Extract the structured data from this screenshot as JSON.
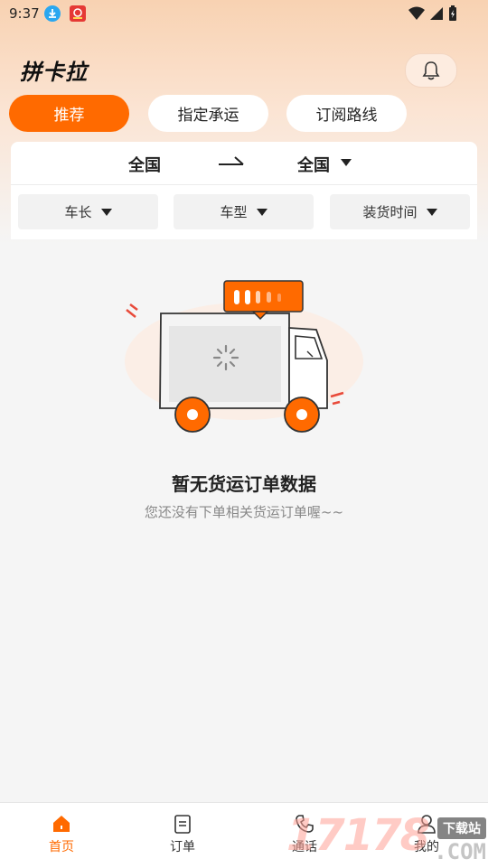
{
  "status_bar": {
    "time": "9:37"
  },
  "header": {
    "brand": "拼卡拉"
  },
  "tabs": [
    {
      "label": "推荐",
      "active": true
    },
    {
      "label": "指定承运",
      "active": false
    },
    {
      "label": "订阅路线",
      "active": false
    }
  ],
  "route": {
    "from": "全国",
    "to": "全国"
  },
  "filters": [
    {
      "label": "车长"
    },
    {
      "label": "车型"
    },
    {
      "label": "装货时间"
    }
  ],
  "empty_state": {
    "title": "暂无货运订单数据",
    "subtitle": "您还没有下单相关货运订单喔~~"
  },
  "bottom_nav": [
    {
      "label": "首页",
      "icon": "home-icon",
      "active": true
    },
    {
      "label": "订单",
      "icon": "order-icon",
      "active": false
    },
    {
      "label": "通话",
      "icon": "phone-icon",
      "active": false
    },
    {
      "label": "我的",
      "icon": "user-icon",
      "active": false
    }
  ],
  "watermark": {
    "digits": "17178",
    "label": "下载站",
    "suffix": ".COM"
  },
  "colors": {
    "accent": "#ff6a00",
    "background": "#f5f5f5"
  }
}
